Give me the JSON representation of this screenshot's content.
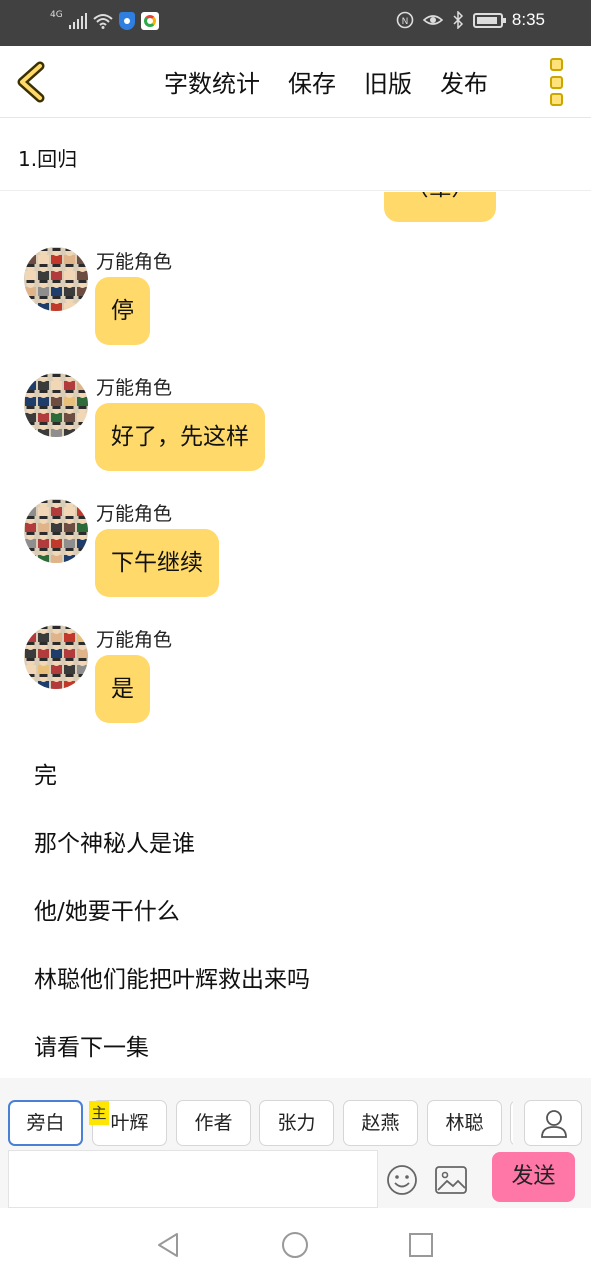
{
  "status_bar": {
    "network": "4G",
    "time": "8:35"
  },
  "toolbar": {
    "actions": [
      "字数统计",
      "保存",
      "旧版",
      "发布"
    ]
  },
  "chapter": {
    "title": "1.回归"
  },
  "chat": {
    "previous_bubble_text": "（晕）",
    "messages": [
      {
        "speaker": "万能角色",
        "text": "停"
      },
      {
        "speaker": "万能角色",
        "text": "好了，先这样"
      },
      {
        "speaker": "万能角色",
        "text": "下午继续"
      },
      {
        "speaker": "万能角色",
        "text": "是"
      }
    ],
    "narration": [
      "完",
      "那个神秘人是谁",
      "他/她要干什么",
      "林聪他们能把叶辉救出来吗",
      "请看下一集"
    ]
  },
  "characters": {
    "items": [
      "旁白",
      "叶辉",
      "作者",
      "张力",
      "赵燕",
      "林聪"
    ],
    "selected": "旁白",
    "lead_badge": "主"
  },
  "composer": {
    "input_value": "",
    "send_label": "发送"
  },
  "colors": {
    "bubble": "#ffd969",
    "send_button": "#ff77a7",
    "selected_chip_border": "#4a7fd6",
    "status_bar": "#414141"
  },
  "icons": [
    "back-chevron-icon",
    "more-menu-icon",
    "emoji-icon",
    "image-icon",
    "user-icon",
    "nav-back-icon",
    "nav-home-icon",
    "nav-recents-icon"
  ]
}
